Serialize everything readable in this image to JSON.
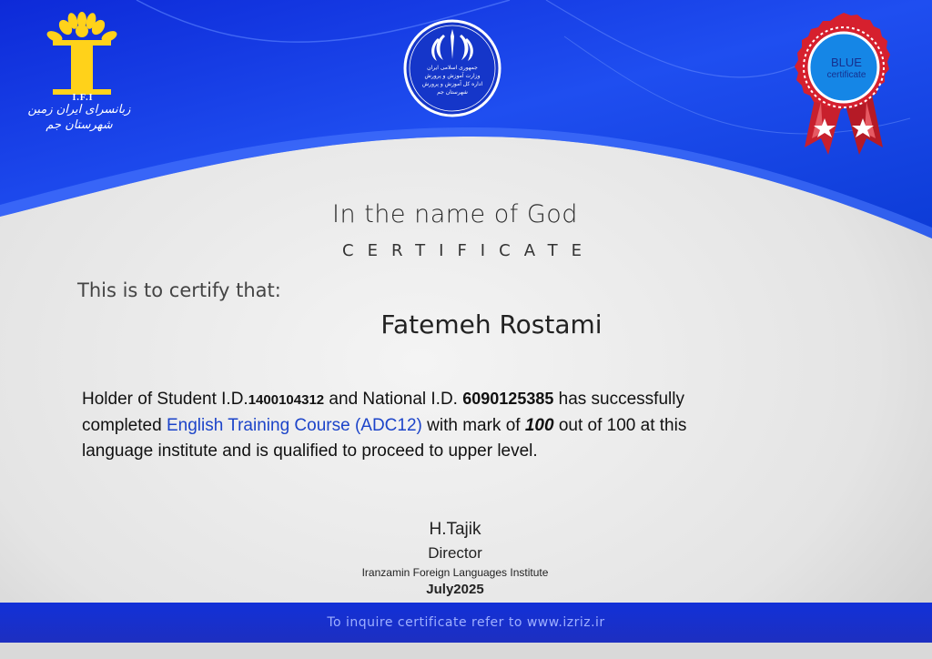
{
  "logos": {
    "ifi_caption": "I.F.I",
    "ifi_fa_line1": "زبانسرای ایران زمین",
    "ifi_fa_line2": "شهرستان جم",
    "emblem_line1": "جمهوری اسلامی ایران",
    "emblem_line2": "وزارت آموزش و پرورش",
    "emblem_line3": "اداره کل آموزش و پرورش شهرستان جم"
  },
  "badge": {
    "title": "BLUE",
    "subtitle": "certificate"
  },
  "header": {
    "invocation": "In the name of God",
    "certificate_word": "CERTIFICATE"
  },
  "certify_line": "This is to certify that:",
  "recipient_name": "Fatemeh Rostami",
  "body": {
    "p1": "Holder of Student I.D.",
    "student_id": "1400104312",
    "p2": " and National I.D. ",
    "national_id": "6090125385",
    "p3": " has successfully",
    "p4": "completed ",
    "course": "English Training Course (ADC12)",
    "p5": " with mark of ",
    "mark": "100",
    "p6": " out of 100 at this",
    "p7": "language institute and is qualified to proceed to upper level."
  },
  "signature": {
    "name": "H.Tajik",
    "title": "Director",
    "institute": "Iranzamin Foreign Languages Institute",
    "date": "July2025"
  },
  "footer": {
    "text": "To inquire certificate refer to www.izriz.ir"
  },
  "colors": {
    "primary_blue": "#1230d8",
    "badge_red": "#d6202e",
    "course_blue": "#1c44c9"
  }
}
